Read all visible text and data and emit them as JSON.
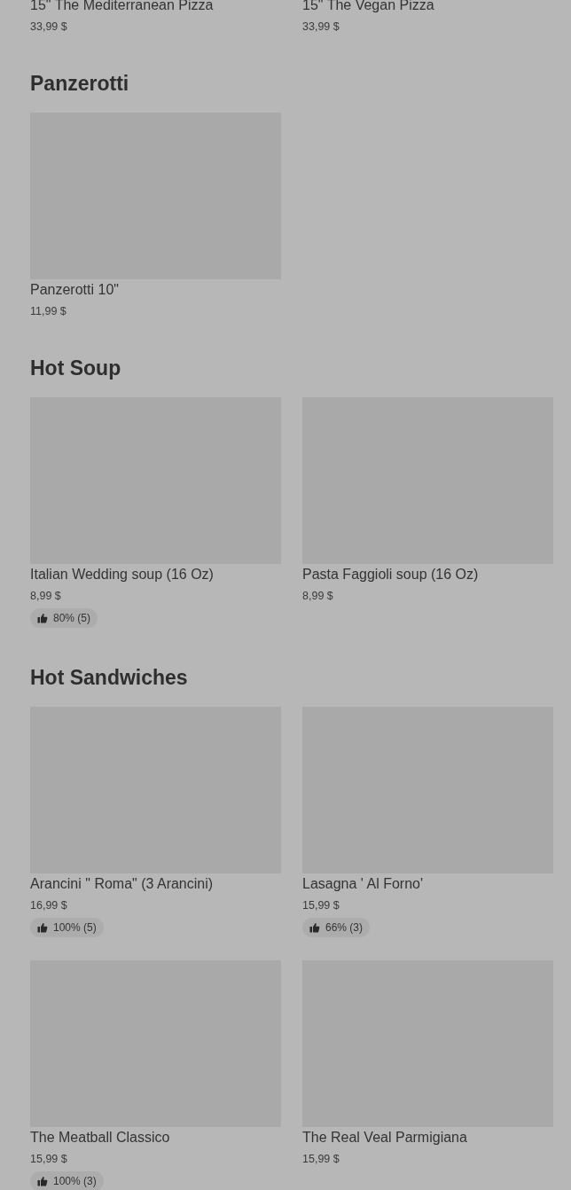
{
  "sections": [
    {
      "items": [
        {
          "name": "15\" The Mediterranean Pizza",
          "price": "33,99 $"
        },
        {
          "name": "15\" The Vegan Pizza",
          "price": "33,99 $"
        }
      ]
    },
    {
      "title": "Panzerotti",
      "items": [
        {
          "name": "Panzerotti 10\"",
          "price": "11,99 $"
        }
      ]
    },
    {
      "title": "Hot Soup",
      "items": [
        {
          "name": "Italian Wedding soup (16 Oz)",
          "price": "8,99 $",
          "rating": "80% (5)"
        },
        {
          "name": "Pasta Faggioli soup (16 Oz)",
          "price": "8,99 $"
        }
      ]
    },
    {
      "title": "Hot Sandwiches",
      "items": [
        {
          "name": "Arancini \" Roma\" (3 Arancini)",
          "price": "16,99 $",
          "rating": "100% (5)"
        },
        {
          "name": "Lasagna ' Al Forno'",
          "price": "15,99 $",
          "rating": "66% (3)"
        },
        {
          "name": "The Meatball Classico",
          "price": "15,99 $",
          "rating": "100% (3)"
        },
        {
          "name": "The Real Veal Parmigiana",
          "price": "15,99 $"
        }
      ]
    }
  ]
}
